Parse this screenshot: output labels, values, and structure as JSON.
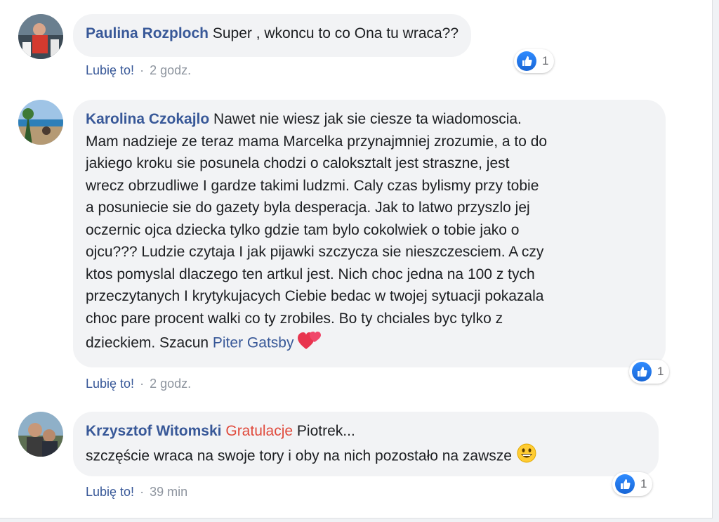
{
  "comments": [
    {
      "author": "Paulina Rozploch",
      "text": " Super , wkoncu to co Ona tu wraca??",
      "like_label": "Lubię to!",
      "separator": "·",
      "time": "2 godz.",
      "reaction_count": "1"
    },
    {
      "author": "Karolina Czokajlo",
      "lines": [
        " Nawet nie wiesz jak sie ciesze ta wiadomoscia.",
        "Mam nadzieje ze teraz mama Marcelka przynajmniej zrozumie, a to do",
        "jakiego kroku sie posunela chodzi o calokszta​lt jest straszne, jest",
        "wrecz obrzudliwe I gardze takimi ludzmi. Caly czas bylismy przy tobie",
        "a posuniecie sie do gazety byla desperacja. Jak to latwo przyszlo jej",
        "oczernic ojca dziecka tylko gdzie tam bylo cokolwiek o tobie jako o",
        "ojcu??? Ludzie czytaja I jak pijawki szczycza sie nieszczesciem. A czy",
        "ktos pomyslal dlaczego ten artkul jest. Nich choc jedna na 100 z tych",
        "przeczytanych I krytykujacych Ciebie bedac w twojej sytuacji pokazala",
        "choc pare procent walki co ty zrobiles. Bo ty chciales byc tylko z"
      ],
      "last_line_prefix": "dzieckiem. Szacun ",
      "mention": "Piter Gatsby",
      "like_label": "Lubię to!",
      "separator": "·",
      "time": "2 godz.",
      "reaction_count": "1"
    },
    {
      "author": "Krzysztof Witomski",
      "mention": "Gratulacje",
      "text_after_mention": " Piotrek...",
      "line2": "szczęście wraca na swoje tory i oby na nich pozostało na zawsze",
      "like_label": "Lubię to!",
      "separator": "·",
      "time": "39 min",
      "reaction_count": "1"
    }
  ],
  "colors": {
    "author": "#385898",
    "bubble": "#f2f3f5",
    "mention_red": "#e04b3d",
    "like_blue": "#1877f2"
  },
  "icons": [
    "like-reaction-icon",
    "two-hearts-emoji-icon",
    "grinning-emoji-icon"
  ]
}
